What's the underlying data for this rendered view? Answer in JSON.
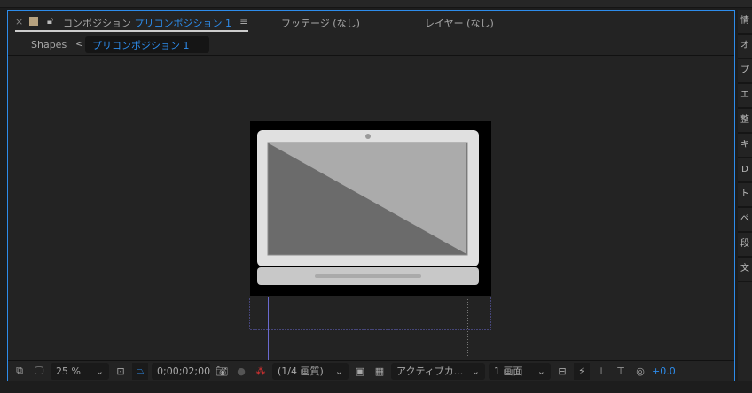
{
  "tabs": {
    "close": "×",
    "comp_prefix": "コンポジション",
    "comp_name": "プリコンポジション 1",
    "menu": "≡",
    "footage": "フッテージ (なし)",
    "layer": "レイヤー (なし)"
  },
  "breadcrumb": {
    "parent": "Shapes",
    "arrow": "<",
    "current": "プリコンポジション 1"
  },
  "toolbar": {
    "zoom": "25 %",
    "timecode": "0;00;02;00",
    "resolution": "(1/4 画質)",
    "camera": "アクティブカ...",
    "views": "1 画面",
    "exposure": "+0.0"
  },
  "side": {
    "items": [
      "情",
      "オ",
      "プ",
      "エ",
      "整",
      "キ",
      "D",
      "ト",
      "ペ",
      "段",
      "文"
    ]
  },
  "colors": {
    "accent": "#2d8ceb",
    "label": "#b7a27f"
  }
}
